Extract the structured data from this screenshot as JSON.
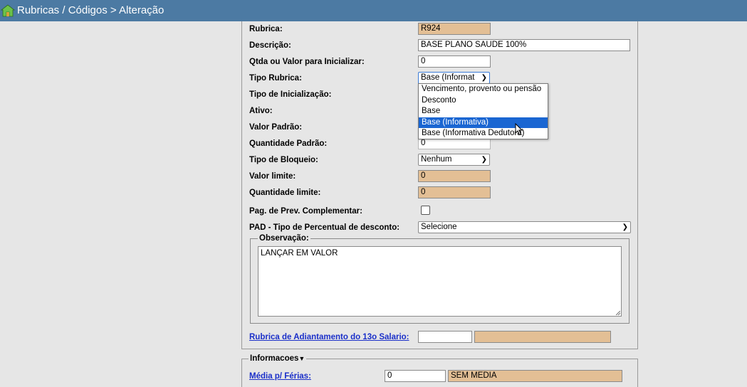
{
  "window": {
    "title": "Rubricas / Códigos > Alteração"
  },
  "form": {
    "rubrica": {
      "label": "Rubrica:",
      "value": "R924"
    },
    "descricao": {
      "label": "Descrição:",
      "value": "BASE PLANO SAUDE 100%"
    },
    "qtda_valor": {
      "label": "Qtda ou Valor para Inicializar:",
      "value": "0"
    },
    "tipo_rubrica": {
      "label": "Tipo Rubrica:",
      "selected": "Base (Informat",
      "options": [
        "Vencimento, provento ou pensão",
        "Desconto",
        "Base",
        "Base (Informativa)",
        "Base (Informativa Dedutora)"
      ]
    },
    "tipo_inicializacao": {
      "label": "Tipo de Inicialização:"
    },
    "ativo": {
      "label": "Ativo:"
    },
    "valor_padrao": {
      "label": "Valor Padrão:"
    },
    "quantidade_padrao": {
      "label": "Quantidade Padrão:",
      "value": "0"
    },
    "tipo_bloqueio": {
      "label": "Tipo de Bloqueio:",
      "selected": "Nenhum"
    },
    "valor_limite": {
      "label": "Valor limite:",
      "value": "0"
    },
    "quantidade_limite": {
      "label": "Quantidade limite:",
      "value": "0"
    },
    "pag_prev": {
      "label": "Pag. de Prev. Complementar:",
      "checked": false
    },
    "pad": {
      "label": "PAD - Tipo de Percentual de desconto:",
      "selected": "Selecione"
    },
    "observacao": {
      "legend": "Observação:",
      "value": "LANÇAR EM VALOR"
    },
    "adiantamento_13": {
      "link": "Rubrica de Adiantamento do 13o Salario:",
      "value": "",
      "desc": ""
    }
  },
  "informacoes": {
    "legend": "Informacoes",
    "media_ferias": {
      "label": "Média p/ Férias:",
      "value": "0",
      "desc": "SEM MEDIA"
    }
  },
  "colors": {
    "titlebar": "#4c7aa3",
    "readonly_field": "#e3bf95",
    "selection": "#1a66d2",
    "link": "#1a2fc9"
  },
  "icons": [
    "app-logo-icon",
    "chevron-down-icon",
    "cursor-pointer-icon"
  ]
}
